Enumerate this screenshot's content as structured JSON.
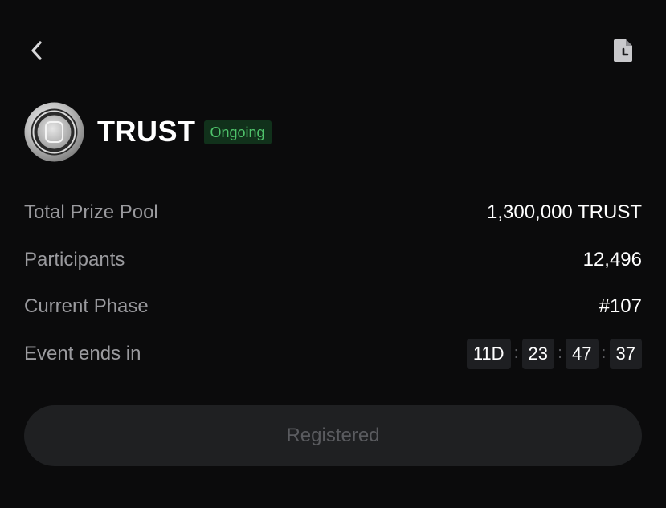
{
  "nav": {
    "back_icon": "chevron-left-icon",
    "history_icon": "document-clock-icon"
  },
  "event": {
    "logo_icon": "trust-coin-icon",
    "title": "TRUST",
    "status": "Ongoing",
    "status_color": "#4fc36b",
    "status_bg": "#11311b"
  },
  "details": {
    "prize_pool_label": "Total Prize Pool",
    "prize_pool_value": "1,300,000 TRUST",
    "participants_label": "Participants",
    "participants_value": "12,496",
    "phase_label": "Current Phase",
    "phase_value": "#107",
    "ends_label": "Event ends in"
  },
  "countdown": {
    "days": "11D",
    "hours": "23",
    "minutes": "47",
    "seconds": "37",
    "separator": ":"
  },
  "action": {
    "button_label": "Registered",
    "enabled": false
  },
  "colors": {
    "background": "#0b0b0c",
    "label_text": "#9a9a9e",
    "value_text": "#ffffff",
    "button_bg": "#1f2022",
    "button_text": "#5a5b5f"
  }
}
